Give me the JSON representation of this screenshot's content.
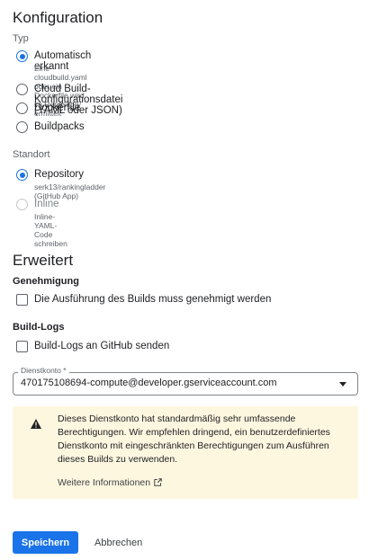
{
  "config": {
    "title": "Konfiguration",
    "type_label": "Typ",
    "type_options": [
      {
        "label": "Automatisch erkannt",
        "hint": "Eine cloudbuild.yaml oder ein Dockerfile wird im Repository ermittelt",
        "checked": true
      },
      {
        "label": "Cloud Build-Konfigurationsdatei (YAML oder JSON)",
        "checked": false
      },
      {
        "label": "Dockerfile",
        "checked": false
      },
      {
        "label": "Buildpacks",
        "checked": false
      }
    ],
    "location_label": "Standort",
    "location_options": [
      {
        "label": "Repository",
        "hint": "serk13/rankingladder (GitHub App)",
        "checked": true,
        "disabled": false
      },
      {
        "label": "Inline",
        "hint": "Inline-YAML-Code schreiben",
        "checked": false,
        "disabled": true
      }
    ]
  },
  "advanced": {
    "title": "Erweitert",
    "approval_label": "Genehmigung",
    "approval_checkbox": "Die Ausführung des Builds muss genehmigt werden",
    "logs_label": "Build-Logs",
    "logs_checkbox": "Build-Logs an GitHub senden",
    "service_account": {
      "label": "Dienstkonto *",
      "value": "470175108694-compute@developer.gserviceaccount.com"
    },
    "warning": {
      "icon": "warning-icon",
      "text": "Dieses Dienstkonto hat standardmäßig sehr umfassende Berechtigungen. Wir empfehlen dringend, ein benutzerdefiniertes Dienstkonto mit eingeschränkten Berechtigungen zum Ausführen dieses Builds zu verwenden.",
      "link": "Weitere Informationen"
    }
  },
  "actions": {
    "save": "Speichern",
    "cancel": "Abbrechen"
  },
  "colors": {
    "accent": "#1a73e8",
    "warning_bg": "#fef7e0"
  }
}
